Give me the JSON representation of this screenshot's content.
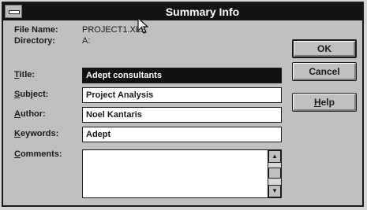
{
  "window": {
    "title": "Summary Info"
  },
  "file_info": {
    "file_name_label": "File Name:",
    "file_name_value": "PROJECT1.XLS",
    "directory_label": "Directory:",
    "directory_value": "A:"
  },
  "fields": {
    "title_label_key": "T",
    "title_label_rest": "itle:",
    "title_value": "Adept consultants",
    "subject_label_key": "S",
    "subject_label_rest": "ubject:",
    "subject_value": "Project Analysis",
    "author_label_key": "A",
    "author_label_rest": "uthor:",
    "author_value": "Noel Kantaris",
    "keywords_label_key": "K",
    "keywords_label_rest": "eywords:",
    "keywords_value": "Adept",
    "comments_label_key": "C",
    "comments_label_rest": "omments:",
    "comments_value": ""
  },
  "buttons": {
    "ok": "OK",
    "cancel": "Cancel",
    "help_key": "H",
    "help_rest": "elp"
  },
  "icons": {
    "system_menu": "system-menu-icon",
    "cursor": "mouse-pointer-icon",
    "scroll_up": "scroll-up-arrow-icon",
    "scroll_down": "scroll-down-arrow-icon"
  }
}
